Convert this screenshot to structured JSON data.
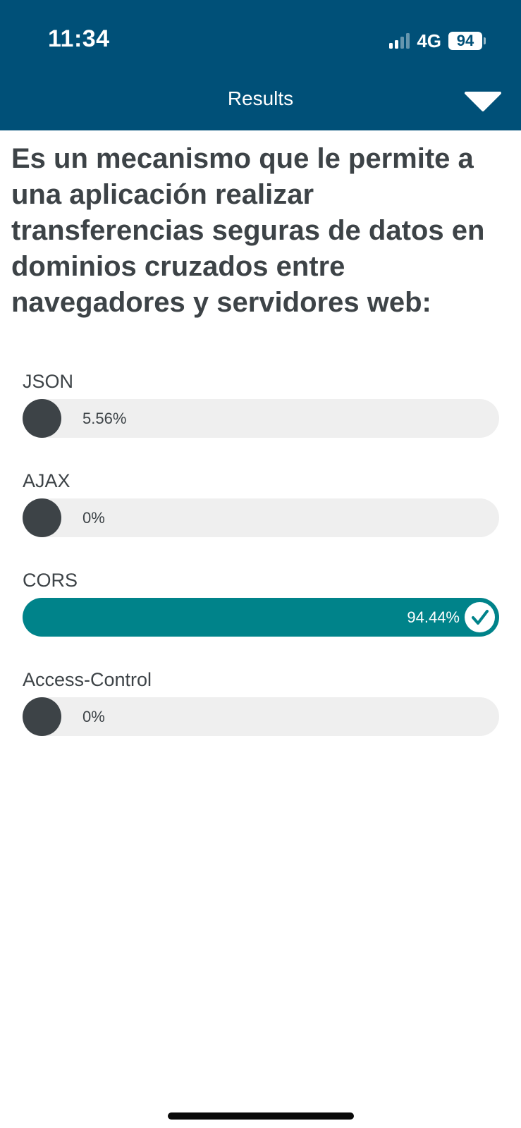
{
  "status_bar": {
    "time": "11:34",
    "network": "4G",
    "battery": "94"
  },
  "header": {
    "title": "Results"
  },
  "question": "Es un mecanismo que le permite a una aplicación realizar transferencias seguras de datos en dominios cruzados entre navegadores y servidores web:",
  "options": [
    {
      "label": "JSON",
      "percent_label": "5.56%",
      "percent": 5.56,
      "correct": false
    },
    {
      "label": "AJAX",
      "percent_label": "0%",
      "percent": 0,
      "correct": false
    },
    {
      "label": "CORS",
      "percent_label": "94.44%",
      "percent": 94.44,
      "correct": true
    },
    {
      "label": "Access-Control",
      "percent_label": "0%",
      "percent": 0,
      "correct": false
    }
  ],
  "colors": {
    "header_bg": "#005078",
    "bar_default": "#3d4347",
    "bar_correct": "#00838a",
    "track": "#efefef",
    "text": "#3d4347"
  }
}
